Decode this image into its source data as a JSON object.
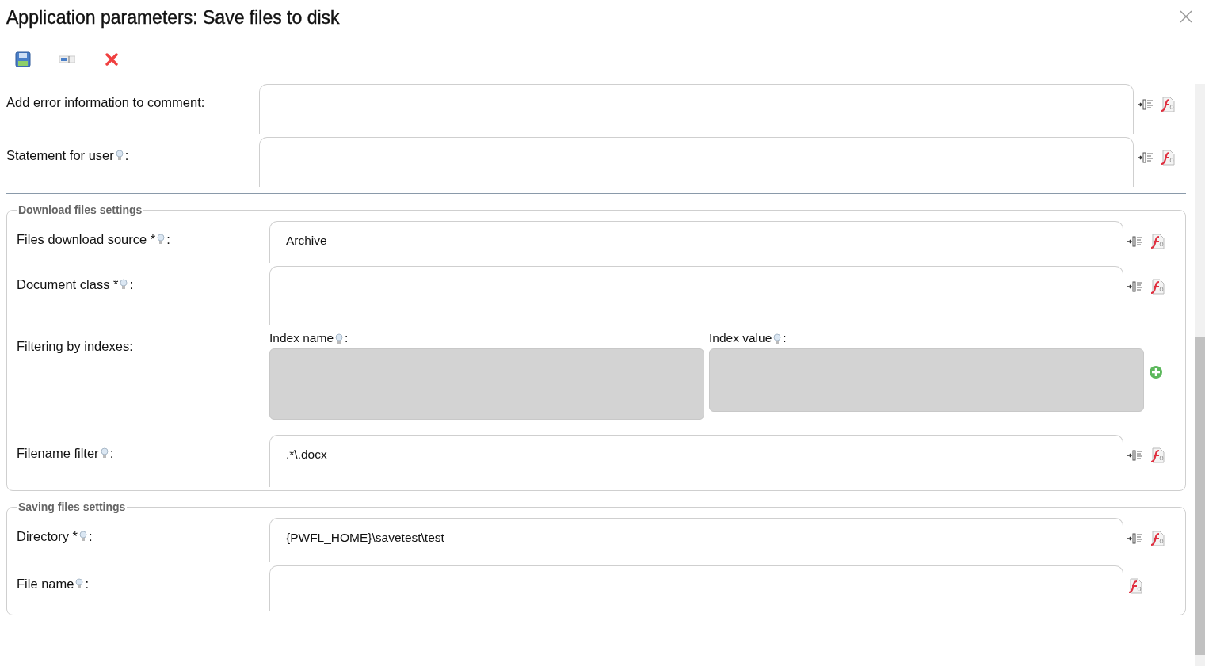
{
  "window": {
    "title": "Application parameters: Save files to disk"
  },
  "toolbar": [
    {
      "kind": "save"
    },
    {
      "kind": "field"
    },
    {
      "kind": "delete"
    }
  ],
  "top_fields": [
    {
      "label": "Add error information to comment:",
      "hint": false,
      "insert_button": true
    },
    {
      "label": "Statement for user",
      "hint": true,
      "suffix": ":",
      "insert_button": true
    }
  ],
  "download_section": {
    "title": "Download files settings",
    "fields": [
      {
        "label": "Files download source *",
        "hint": true,
        "suffix": ":",
        "value": "Archive",
        "insert_button": true
      },
      {
        "label": "Document class *",
        "hint": true,
        "suffix": ":",
        "insert_button": true
      }
    ],
    "filtering": {
      "label": "Filtering by indexes:",
      "columns": [
        {
          "label": "Index name",
          "hint": true,
          "suffix": ":"
        },
        {
          "label": "Index value",
          "hint": true,
          "suffix": ":"
        }
      ]
    },
    "filename_filter": {
      "label": "Filename filter",
      "hint": true,
      "suffix": ":",
      "value": ".*\\.docx",
      "insert_button": true
    }
  },
  "saving_section": {
    "title": "Saving files settings",
    "fields": [
      {
        "label": "Directory *",
        "hint": true,
        "suffix": ":",
        "value": "{PWFL_HOME}\\savetest\\test",
        "insert_button": true
      },
      {
        "label": "File name",
        "hint": true,
        "suffix": ":",
        "insert_button": false
      }
    ]
  }
}
